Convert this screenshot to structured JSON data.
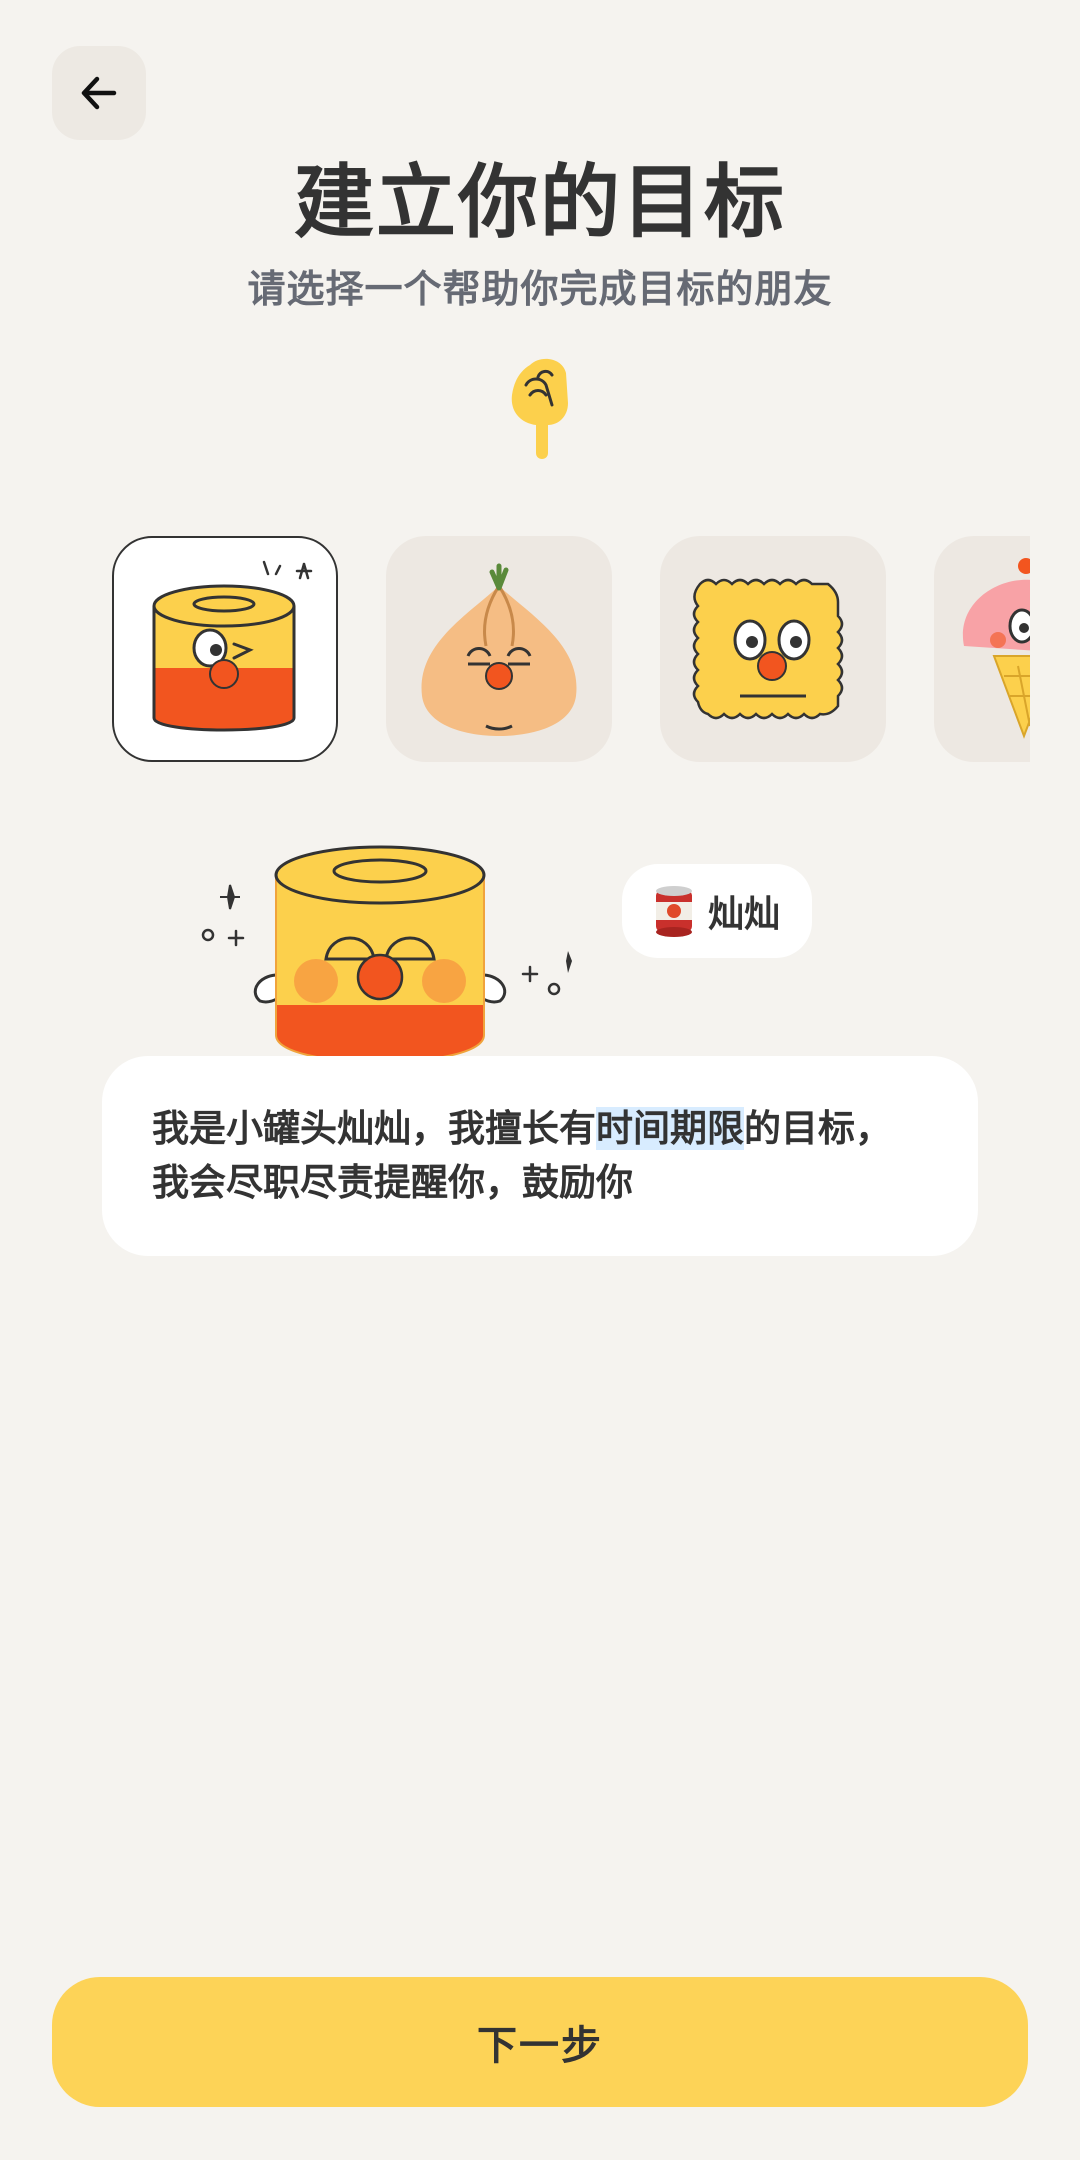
{
  "header": {
    "title": "建立你的目标",
    "subtitle": "请选择一个帮助你完成目标的朋友"
  },
  "icons": {
    "back": "arrow-left-icon",
    "pointer": "pointing-hand-icon",
    "can": "tomato-can-icon"
  },
  "companions": [
    {
      "id": "can",
      "selected": true
    },
    {
      "id": "onion",
      "selected": false
    },
    {
      "id": "cracker",
      "selected": false
    },
    {
      "id": "ice-cream",
      "selected": false
    }
  ],
  "selected_companion": {
    "name": "灿灿",
    "intro_before": "我是小罐头灿灿，我擅长有",
    "intro_highlight": "时间期限",
    "intro_after": "的目标，我会尽职尽责提醒你，鼓励你"
  },
  "footer": {
    "next_label": "下一步"
  },
  "colors": {
    "background": "#f5f3ef",
    "accent_yellow": "#fdd357",
    "nose_orange": "#f2551f",
    "highlight": "#d8ecff"
  }
}
